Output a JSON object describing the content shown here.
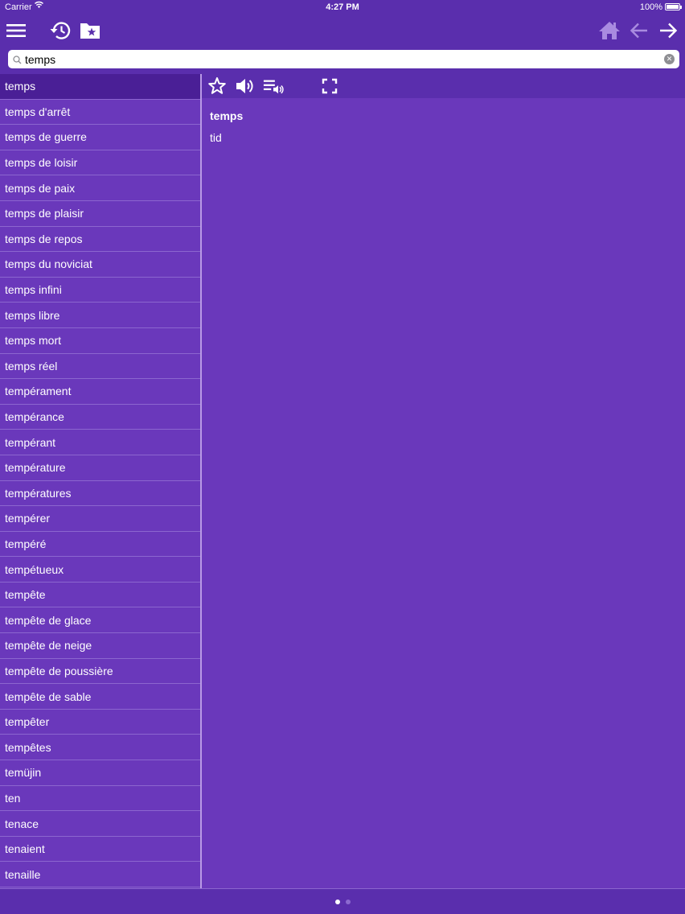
{
  "status_bar": {
    "carrier": "Carrier",
    "time": "4:27 PM",
    "battery": "100%",
    "wifi_icon": "wifi-icon"
  },
  "toolbar": {
    "icons": [
      "menu-icon",
      "history-icon",
      "favorites-folder-icon",
      "home-icon",
      "back-arrow-icon",
      "forward-arrow-icon"
    ]
  },
  "search": {
    "value": "temps",
    "placeholder": ""
  },
  "word_list": {
    "items": [
      "temps",
      "temps d'arrêt",
      "temps de guerre",
      "temps de loisir",
      "temps de paix",
      "temps de plaisir",
      "temps de repos",
      "temps du noviciat",
      "temps infini",
      "temps libre",
      "temps mort",
      "temps réel",
      "tempérament",
      "tempérance",
      "tempérant",
      "température",
      "températures",
      "tempérer",
      "tempéré",
      "tempétueux",
      "tempête",
      "tempête de glace",
      "tempête de neige",
      "tempête de poussière",
      "tempête de sable",
      "tempêter",
      "tempêtes",
      "temüjin",
      "ten",
      "tenace",
      "tenaient",
      "tenaille"
    ],
    "selected_index": 0
  },
  "detail": {
    "word": "temps",
    "translation": "tid",
    "icons": [
      "star-icon",
      "speaker-icon",
      "playlist-audio-icon",
      "fullscreen-icon"
    ]
  },
  "pagination": {
    "pages": 2,
    "current": 1
  },
  "colors": {
    "background": "#6a38bb",
    "bar": "#5a2ead",
    "selected_row": "#4a1f96",
    "row_separator": "#8c66cf",
    "home_icon": "#a98be0"
  }
}
